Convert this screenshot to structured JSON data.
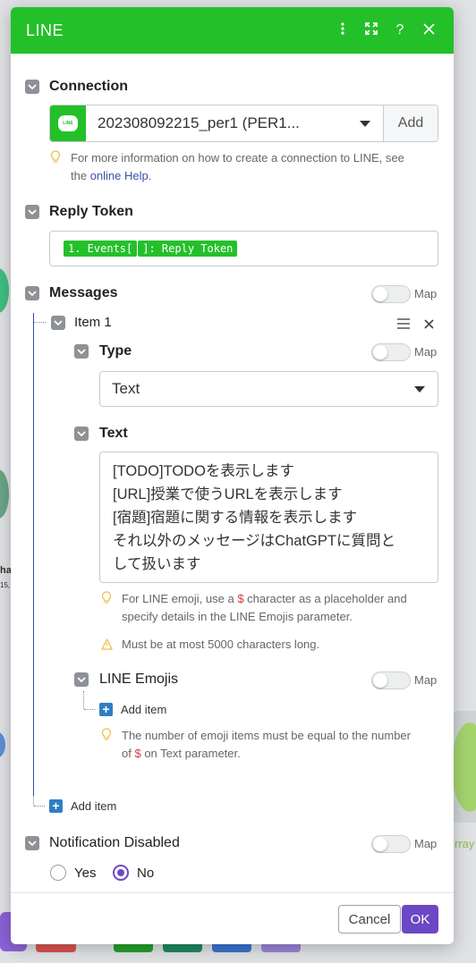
{
  "dialog": {
    "title": "LINE",
    "icons": [
      "more-vertical-icon",
      "expand-icon",
      "help-icon",
      "close-icon"
    ],
    "accent_color": "#24c02a",
    "primary_color": "#6b48c4"
  },
  "connection": {
    "label": "Connection",
    "logo_text": "LINE",
    "selected": "202308092215_per1 (PER1...",
    "add_label": "Add",
    "hint_prefix": "For more information on how to create a connection to LINE, see",
    "hint_middle": "the ",
    "hint_link": "online Help",
    "hint_suffix": "."
  },
  "reply_token": {
    "label": "Reply Token",
    "pill1": "1. Events[",
    "pill2": "]: Reply Token"
  },
  "messages": {
    "label": "Messages",
    "map_label": "Map",
    "item_label": "Item 1",
    "type": {
      "label": "Type",
      "map_label": "Map",
      "value": "Text"
    },
    "text": {
      "label": "Text",
      "lines": [
        "[TODO]TODOを表示します",
        "[URL]授業で使うURLを表示します",
        "[宿題]宿題に関する情報を表示します",
        "それ以外のメッセージはChatGPTに質問と",
        "して扱います"
      ],
      "hint1_a": "For LINE emoji, use a ",
      "hint1_dollar": "$",
      "hint1_b": " character as a placeholder and",
      "hint1_line2": "specify details in the LINE Emojis parameter.",
      "hint2": "Must be at most 5000 characters long."
    },
    "emojis": {
      "label": "LINE Emojis",
      "map_label": "Map",
      "add_item": "Add item",
      "hint_line1": "The number of emoji items must be equal to the number",
      "hint_of": "of ",
      "hint_dollar": "$",
      "hint_rest": " on Text parameter."
    },
    "add_item": "Add item"
  },
  "notification": {
    "label": "Notification Disabled",
    "map_label": "Map",
    "option_yes": "Yes",
    "option_no": "No",
    "selected": "No"
  },
  "footer": {
    "cancel": "Cancel",
    "ok": "OK"
  },
  "background": {
    "text1": "ha",
    "text2": "15,",
    "text3": "rray"
  }
}
